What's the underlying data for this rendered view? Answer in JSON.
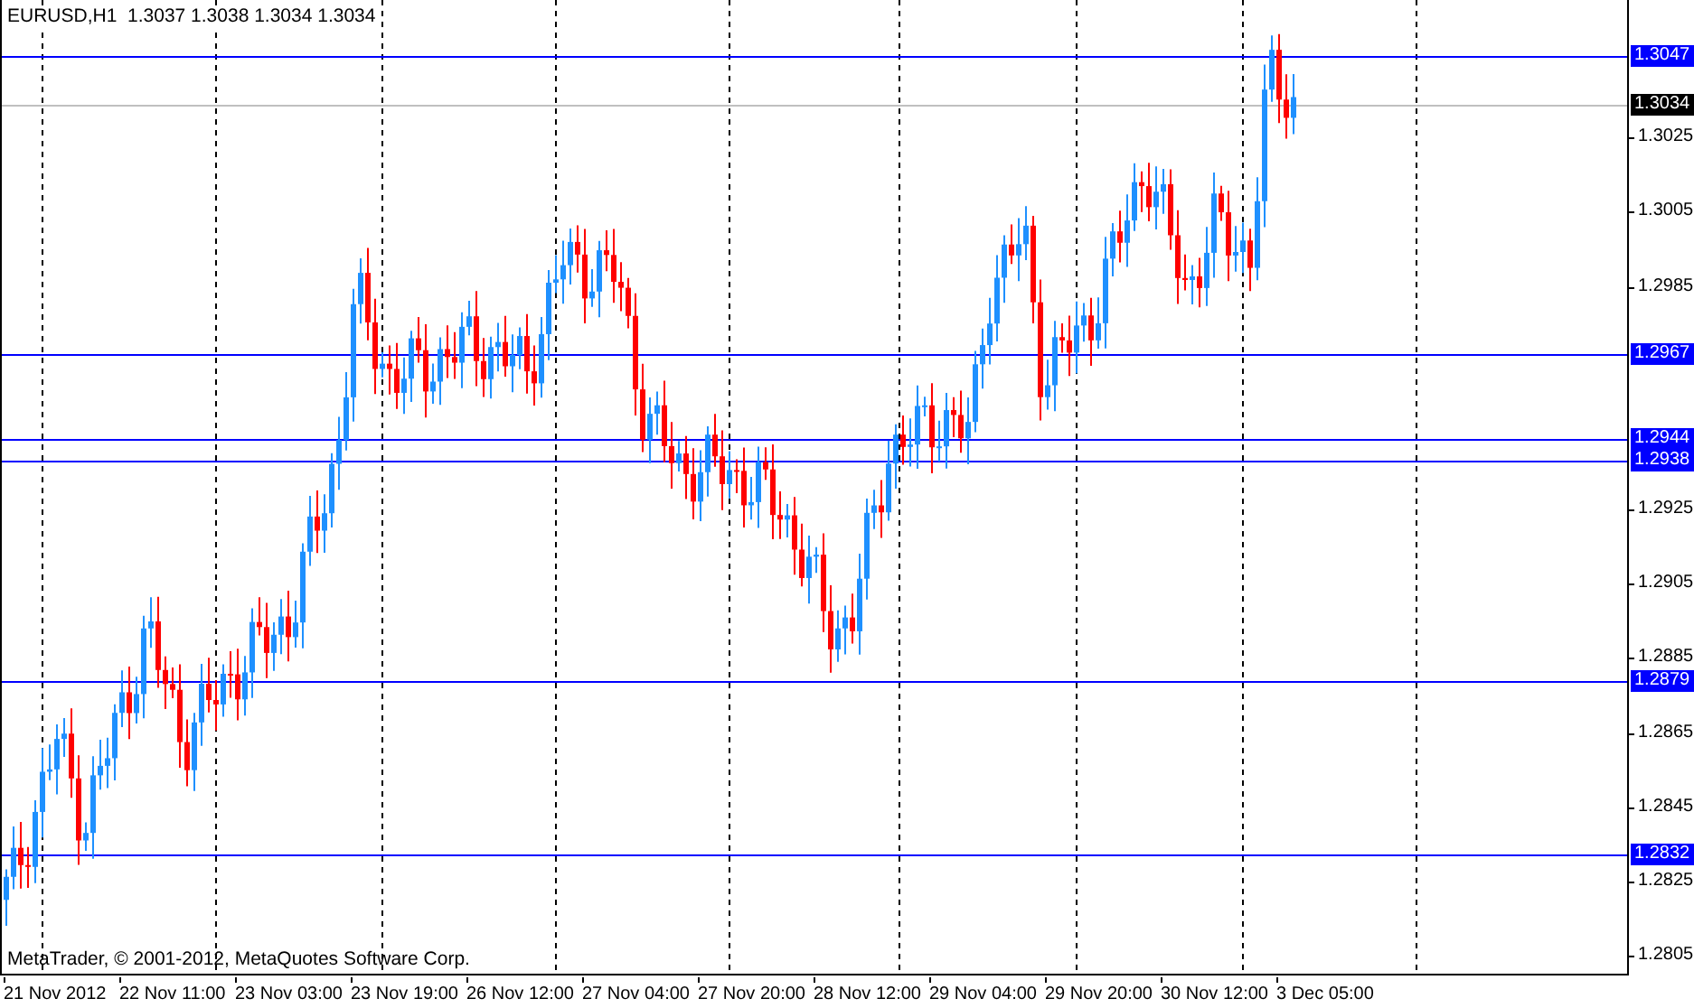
{
  "header": {
    "symbol": "EURUSD,H1",
    "ohlc": [
      "1.3037",
      "1.3038",
      "1.3034",
      "1.3034"
    ]
  },
  "price_axis": [
    "1.3025",
    "1.3005",
    "1.2985",
    "1.2925",
    "1.2905",
    "1.2885",
    "1.2865",
    "1.2845",
    "1.2825",
    "1.2805"
  ],
  "levels": [
    {
      "price": "1.3047",
      "kind": "level"
    },
    {
      "price": "1.3034",
      "kind": "current"
    },
    {
      "price": "1.2967",
      "kind": "level"
    },
    {
      "price": "1.2944",
      "kind": "level"
    },
    {
      "price": "1.2938",
      "kind": "level"
    },
    {
      "price": "1.2879",
      "kind": "level"
    },
    {
      "price": "1.2832",
      "kind": "level"
    }
  ],
  "time_axis": [
    "21 Nov 2012",
    "22 Nov 11:00",
    "23 Nov 03:00",
    "23 Nov 19:00",
    "26 Nov 12:00",
    "27 Nov 04:00",
    "27 Nov 20:00",
    "28 Nov 12:00",
    "29 Nov 04:00",
    "29 Nov 20:00",
    "30 Nov 12:00",
    "3 Dec 05:00"
  ],
  "copyright": "MetaTrader, © 2001-2012, MetaQuotes Software Corp."
}
